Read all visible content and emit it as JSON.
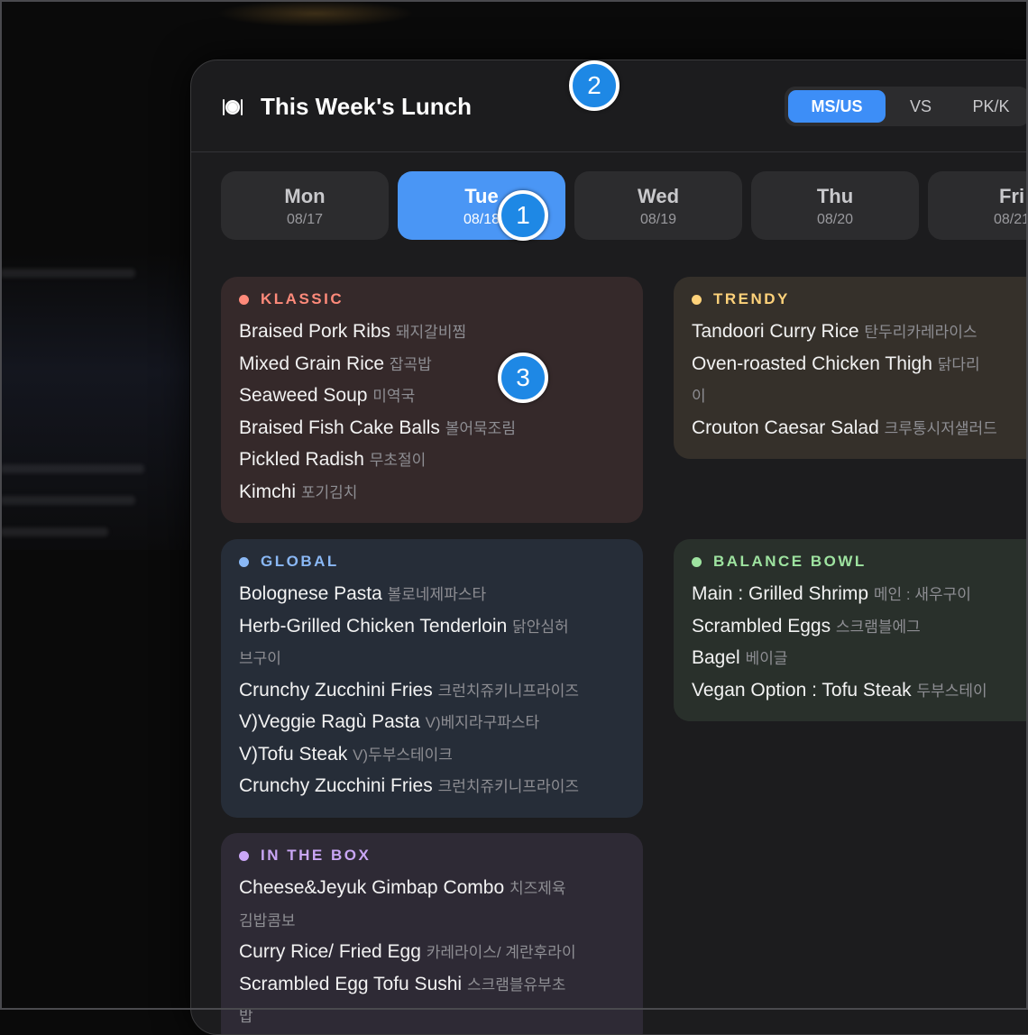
{
  "header": {
    "title": "This Week's Lunch",
    "icon": "plate-cutlery-icon",
    "campus_tabs": [
      {
        "label": "MS/US",
        "active": true
      },
      {
        "label": "VS",
        "active": false
      },
      {
        "label": "PK/K",
        "active": false
      }
    ]
  },
  "days": [
    {
      "name": "Mon",
      "date": "08/17",
      "active": false
    },
    {
      "name": "Tue",
      "date": "08/18",
      "active": true
    },
    {
      "name": "Wed",
      "date": "08/19",
      "active": false
    },
    {
      "name": "Thu",
      "date": "08/20",
      "active": false
    },
    {
      "name": "Fri",
      "date": "08/21",
      "active": false
    }
  ],
  "cards": [
    {
      "title": "KLASSIC",
      "accent": "#ff8a7a",
      "bg": "#35292a",
      "items": [
        {
          "en": "Braised Pork Ribs",
          "ko": "돼지갈비찜"
        },
        {
          "en": "Mixed Grain Rice",
          "ko": "잡곡밥"
        },
        {
          "en": "Seaweed Soup",
          "ko": "미역국"
        },
        {
          "en": "Braised Fish Cake Balls",
          "ko": "볼어묵조림"
        },
        {
          "en": "Pickled Radish",
          "ko": "무초절이"
        },
        {
          "en": "Kimchi",
          "ko": "포기김치"
        }
      ]
    },
    {
      "title": "TRENDY",
      "accent": "#ffd27a",
      "bg": "#35302a",
      "items": [
        {
          "en": "Tandoori Curry Rice",
          "ko": "탄두리카레라이스"
        },
        {
          "en": "Oven-roasted Chicken Thigh",
          "ko": "닭다리"
        },
        {
          "en": "",
          "ko": "이"
        },
        {
          "en": "Crouton Caesar Salad",
          "ko": "크루통시저샐러드"
        }
      ]
    },
    {
      "title": "GLOBAL",
      "accent": "#8ab8f5",
      "bg": "#262d38",
      "items": [
        {
          "en": "Bolognese Pasta",
          "ko": "볼로네제파스타"
        },
        {
          "en": "Herb-Grilled Chicken Tenderloin",
          "ko": "닭안심허"
        },
        {
          "en": "",
          "ko": "브구이"
        },
        {
          "en": "Crunchy Zucchini Fries",
          "ko": "크런치쥬키니프라이즈"
        },
        {
          "en": "V)Veggie Ragù Pasta",
          "ko": "V)베지라구파스타"
        },
        {
          "en": "V)Tofu Steak",
          "ko": "V)두부스테이크"
        },
        {
          "en": "Crunchy Zucchini Fries",
          "ko": "크런치쥬키니프라이즈"
        }
      ]
    },
    {
      "title": "BALANCE BOWL",
      "accent": "#9ee3a0",
      "bg": "#29302b",
      "items": [
        {
          "en": "Main : Grilled Shrimp",
          "ko": "메인 : 새우구이"
        },
        {
          "en": "Scrambled Eggs",
          "ko": "스크램블에그"
        },
        {
          "en": "Bagel",
          "ko": "베이글"
        },
        {
          "en": "Vegan Option : Tofu Steak",
          "ko": "두부스테이"
        }
      ]
    },
    {
      "title": "IN THE BOX",
      "accent": "#c9a6f5",
      "bg": "#2e2a35",
      "items": [
        {
          "en": "Cheese&Jeyuk Gimbap Combo",
          "ko": "치즈제육"
        },
        {
          "en": "",
          "ko": "김밥콤보"
        },
        {
          "en": "Curry Rice/ Fried Egg",
          "ko": "카레라이스/ 계란후라이"
        },
        {
          "en": "Scrambled Egg Tofu Sushi",
          "ko": "스크램블유부초"
        },
        {
          "en": "",
          "ko": "밥"
        }
      ]
    }
  ],
  "markers": [
    "1",
    "2",
    "3"
  ]
}
